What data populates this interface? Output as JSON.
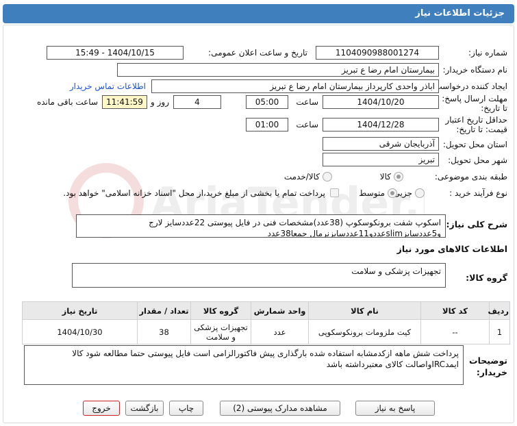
{
  "header": {
    "title": "جزئیات اطلاعات نیاز"
  },
  "need_number": {
    "label": "شماره نیاز:",
    "value": "1104090988001274"
  },
  "announce_datetime": {
    "label": "تاریخ و ساعت اعلان عمومی:",
    "value": "1404/10/15 - 15:49"
  },
  "buyer_org": {
    "label": "نام دستگاه خریدار:",
    "value": "بیمارستان امام رضا  ع  تبریز"
  },
  "requester": {
    "label": "ایجاد کننده درخواست:",
    "value": "اباذر واحدی کارپرداز بیمارستان امام رضا  ع  تبریز",
    "contact_link": "اطلاعات تماس خریدار"
  },
  "reply_deadline": {
    "label": "مهلت ارسال پاسخ: تا تاریخ:",
    "date": "1404/10/20",
    "time_label": "ساعت",
    "time": "05:00",
    "days": "4",
    "days_label": "روز و",
    "remaining": "11:41:59",
    "remaining_label": "ساعت باقی مانده"
  },
  "price_validity": {
    "label": "حداقل تاریخ اعتبار قیمت: تا تاریخ:",
    "date": "1404/12/28",
    "time_label": "ساعت",
    "time": "01:00"
  },
  "province": {
    "label": "استان محل تحویل:",
    "value": "آذربایجان شرقی"
  },
  "city": {
    "label": "شهر محل تحویل:",
    "value": "تبریز"
  },
  "category": {
    "label": "طبقه بندی موضوعی:",
    "options": [
      "کالا",
      "کالا/خدمت"
    ],
    "selected": "کالا"
  },
  "purchase_process": {
    "label": "نوع فرآیند خرید :",
    "options": [
      "جزیی",
      "متوسط"
    ],
    "selected": "متوسط",
    "treasury_note": "پرداخت تمام یا بخشی از مبلغ خرید،از محل \"اسناد خزانه اسلامی\" خواهد بود."
  },
  "description": {
    "label": "شرح کلی نیاز:",
    "line1": "اسکوپ شفت برونکوسکوپ (38عدد)مشخصات فنی در فایل پیوستی  22عددسایز لارج",
    "line2": "و5عددسایزslimعددو11عددسایزنرمال جمعا38عدد"
  },
  "goods_info": {
    "title": "اطلاعات کالاهای مورد نیاز"
  },
  "goods_group": {
    "label": "گروه کالا:",
    "value": "تجهیزات پزشکی و سلامت"
  },
  "table": {
    "headers": [
      "ردیف",
      "کد کالا",
      "نام کالا",
      "واحد شمارش",
      "گروه کالا",
      "تعداد / مقدار",
      "تاریخ نیاز"
    ],
    "rows": [
      {
        "row": "1",
        "code": "--",
        "name": "کیت ملزومات برونکوسکوپی",
        "unit": "عدد",
        "group_line1": "تجهیزات پزشکی",
        "group_line2": "و سلامت",
        "qty": "38",
        "date": "1404/10/30"
      }
    ]
  },
  "buyer_notes": {
    "label": "توضیحات خریدار:",
    "line1": "پرداخت شش  ماهه ازکدمشابه استفاده شده بارگذاری پیش فاکتورالزامی است فایل پیوستی حتما مطالعه شود کالا",
    "line2": "ایمدIRCواصالت کالای معتبرداشته باشد"
  },
  "buttons": {
    "reply": "پاسخ به نیاز",
    "docs": "مشاهده مدارک پیوستی (2)",
    "print": "چاپ",
    "back": "بازگشت",
    "exit": "خروج"
  },
  "watermark": {
    "text": "AriaTender.neT"
  }
}
